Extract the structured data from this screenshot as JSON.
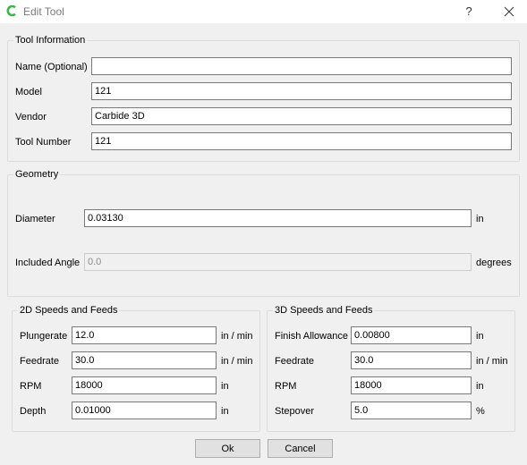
{
  "window": {
    "title": "Edit Tool",
    "help_label": "?",
    "close_icon": "close-icon",
    "app_icon": "carbide-c-icon",
    "app_icon_color": "#3fb54a"
  },
  "tool_information": {
    "title": "Tool Information",
    "name_label": "Name (Optional)",
    "name_value": "",
    "model_label": "Model",
    "model_value": "121",
    "vendor_label": "Vendor",
    "vendor_value": "Carbide 3D",
    "tool_number_label": "Tool Number",
    "tool_number_value": "121"
  },
  "geometry": {
    "title": "Geometry",
    "diameter_label": "Diameter",
    "diameter_value": "0.03130",
    "diameter_unit": "in",
    "angle_label": "Included Angle",
    "angle_value": "0.0",
    "angle_unit": "degrees"
  },
  "speeds_2d": {
    "title": "2D Speeds and Feeds",
    "plungerate_label": "Plungerate",
    "plungerate_value": "12.0",
    "plungerate_unit": "in / min",
    "feedrate_label": "Feedrate",
    "feedrate_value": "30.0",
    "feedrate_unit": "in / min",
    "rpm_label": "RPM",
    "rpm_value": "18000",
    "rpm_unit": "in",
    "depth_label": "Depth",
    "depth_value": "0.01000",
    "depth_unit": "in"
  },
  "speeds_3d": {
    "title": "3D Speeds and Feeds",
    "finish_label": "Finish Allowance",
    "finish_value": "0.00800",
    "finish_unit": "in",
    "feedrate_label": "Feedrate",
    "feedrate_value": "30.0",
    "feedrate_unit": "in / min",
    "rpm_label": "RPM",
    "rpm_value": "18000",
    "rpm_unit": "in",
    "stepover_label": "Stepover",
    "stepover_value": "5.0",
    "stepover_unit": "%"
  },
  "buttons": {
    "ok_label": "Ok",
    "cancel_label": "Cancel"
  }
}
